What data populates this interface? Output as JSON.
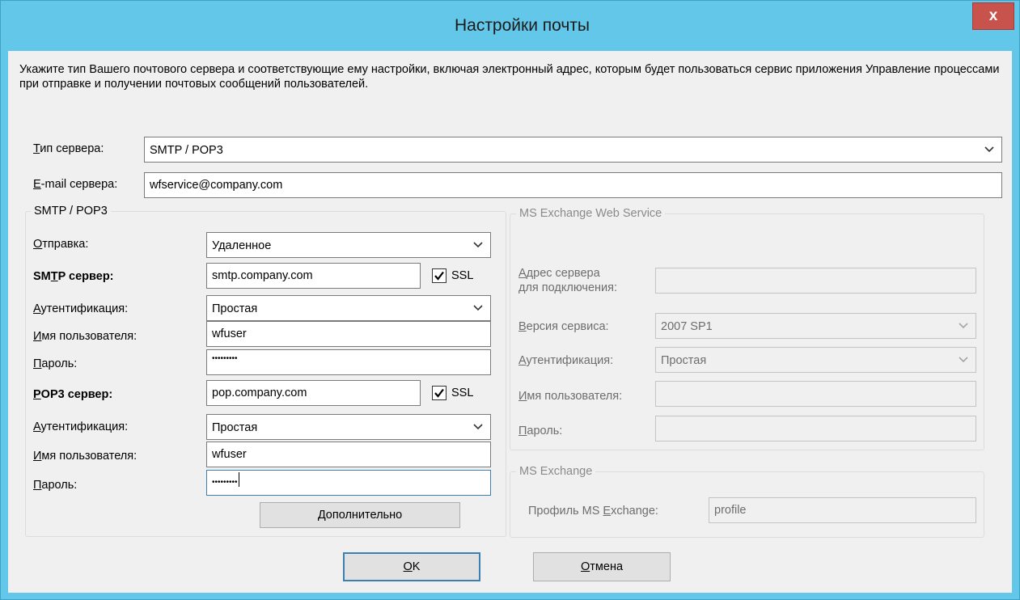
{
  "window": {
    "title": "Настройки почты",
    "close_glyph": "x"
  },
  "intro_text": "Укажите тип Вашего почтового сервера и соответствующие ему настройки, включая электронный адрес, которым будет пользоваться сервис приложения Управление процессами при отправке и получении почтовых сообщений пользователей.",
  "server_type": {
    "label_mnemonic": "Т",
    "label_rest": "ип сервера:",
    "value": "SMTP / POP3"
  },
  "server_email": {
    "label_mnemonic": "E",
    "label_rest": "-mail сервера:",
    "value": "wfservice@company.com"
  },
  "smtp_pop3": {
    "legend": "SMTP / POP3",
    "send_mode": {
      "label_mnemonic": "О",
      "label_rest": "тправка:",
      "value": "Удаленное"
    },
    "smtp_server": {
      "label_prefix": "SM",
      "label_mnemonic": "T",
      "label_rest": "P сервер:",
      "value": "smtp.company.com",
      "ssl_label": "SSL",
      "ssl_checked": true
    },
    "smtp_auth": {
      "label_mnemonic": "А",
      "label_rest": "утентификация:",
      "value": "Простая"
    },
    "smtp_user": {
      "label_mnemonic": "И",
      "label_rest": "мя пользователя:",
      "value": "wfuser"
    },
    "smtp_password": {
      "label_mnemonic": "П",
      "label_rest": "ароль:",
      "value": "•••••••••"
    },
    "pop3_server": {
      "label_mnemonic": "P",
      "label_rest": "OP3 сервер:",
      "value": "pop.company.com",
      "ssl_label": "SSL",
      "ssl_checked": true
    },
    "pop3_auth": {
      "label_mnemonic": "А",
      "label_rest": "утентификация:",
      "value": "Простая"
    },
    "pop3_user": {
      "label_mnemonic": "И",
      "label_rest": "мя пользователя:",
      "value": "wfuser"
    },
    "pop3_password": {
      "label_mnemonic": "П",
      "label_rest": "ароль:",
      "value": "•••••••••"
    },
    "advanced_button": {
      "label_mnemonic": "Д",
      "label_rest": "ополнительно"
    }
  },
  "ews": {
    "legend": "MS Exchange Web Service",
    "address": {
      "label_mnemonic": "А",
      "label_rest": "дрес сервера",
      "label_line2": "для подключения:",
      "value": ""
    },
    "version": {
      "label_mnemonic": "В",
      "label_rest": "ерсия сервиса:",
      "value": "2007 SP1"
    },
    "auth": {
      "label_mnemonic": "А",
      "label_rest": "утентификация:",
      "value": "Простая"
    },
    "user": {
      "label_mnemonic": "И",
      "label_rest": "мя пользователя:",
      "value": ""
    },
    "password": {
      "label_mnemonic": "П",
      "label_rest": "ароль:",
      "value": ""
    }
  },
  "exchange": {
    "legend": "MS Exchange",
    "profile": {
      "label_prefix": "Профиль MS ",
      "label_mnemonic": "E",
      "label_rest": "xchange:",
      "value": "profile"
    }
  },
  "buttons": {
    "ok": {
      "label_mnemonic": "O",
      "label_rest": "K"
    },
    "cancel": {
      "label_mnemonic": "О",
      "label_rest": "тмена"
    }
  },
  "colors": {
    "titlebar": "#63c7e9",
    "close_button": "#c8524c",
    "client_background": "#f0f0f0",
    "focus_border": "#3c7fb1"
  },
  "icons": {
    "dropdown": "chevron-down-icon",
    "checkbox": "checkmark-icon"
  }
}
